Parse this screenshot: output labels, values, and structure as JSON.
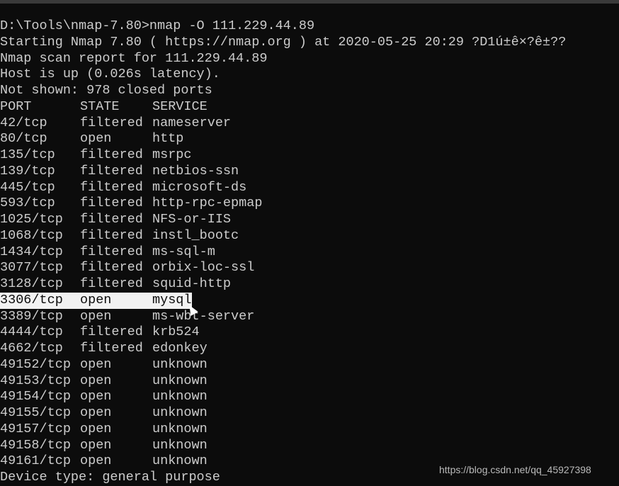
{
  "terminal": {
    "pre_lines": [
      "D:\\Tools\\nmap-7.80>nmap -O 111.229.44.89",
      "Starting Nmap 7.80 ( https://nmap.org ) at 2020-05-25 20:29 ?D1ú±ê×?ê±??",
      "Nmap scan report for 111.229.44.89",
      "Host is up (0.026s latency).",
      "Not shown: 978 closed ports"
    ],
    "header": {
      "port": "PORT",
      "state": "STATE",
      "service": "SERVICE"
    },
    "ports": [
      {
        "port": "42/tcp",
        "state": "filtered",
        "service": "nameserver"
      },
      {
        "port": "80/tcp",
        "state": "open",
        "service": "http"
      },
      {
        "port": "135/tcp",
        "state": "filtered",
        "service": "msrpc"
      },
      {
        "port": "139/tcp",
        "state": "filtered",
        "service": "netbios-ssn"
      },
      {
        "port": "445/tcp",
        "state": "filtered",
        "service": "microsoft-ds"
      },
      {
        "port": "593/tcp",
        "state": "filtered",
        "service": "http-rpc-epmap"
      },
      {
        "port": "1025/tcp",
        "state": "filtered",
        "service": "NFS-or-IIS"
      },
      {
        "port": "1068/tcp",
        "state": "filtered",
        "service": "instl_bootc"
      },
      {
        "port": "1434/tcp",
        "state": "filtered",
        "service": "ms-sql-m"
      },
      {
        "port": "3077/tcp",
        "state": "filtered",
        "service": "orbix-loc-ssl"
      },
      {
        "port": "3128/tcp",
        "state": "filtered",
        "service": "squid-http"
      },
      {
        "port": "3306/tcp",
        "state": "open",
        "service": "mysql",
        "selected": true
      },
      {
        "port": "3389/tcp",
        "state": "open",
        "service": "ms-wbt-server"
      },
      {
        "port": "4444/tcp",
        "state": "filtered",
        "service": "krb524"
      },
      {
        "port": "4662/tcp",
        "state": "filtered",
        "service": "edonkey"
      },
      {
        "port": "49152/tcp",
        "state": "open",
        "service": "unknown"
      },
      {
        "port": "49153/tcp",
        "state": "open",
        "service": "unknown"
      },
      {
        "port": "49154/tcp",
        "state": "open",
        "service": "unknown"
      },
      {
        "port": "49155/tcp",
        "state": "open",
        "service": "unknown"
      },
      {
        "port": "49157/tcp",
        "state": "open",
        "service": "unknown"
      },
      {
        "port": "49158/tcp",
        "state": "open",
        "service": "unknown"
      },
      {
        "port": "49161/tcp",
        "state": "open",
        "service": "unknown"
      }
    ],
    "post_lines": [
      "Device type: general purpose"
    ]
  },
  "watermark": "https://blog.csdn.net/qq_45927398",
  "colors": {
    "background": "#0c0c0c",
    "text": "#cccccc",
    "selection": "#f2f2f2"
  }
}
